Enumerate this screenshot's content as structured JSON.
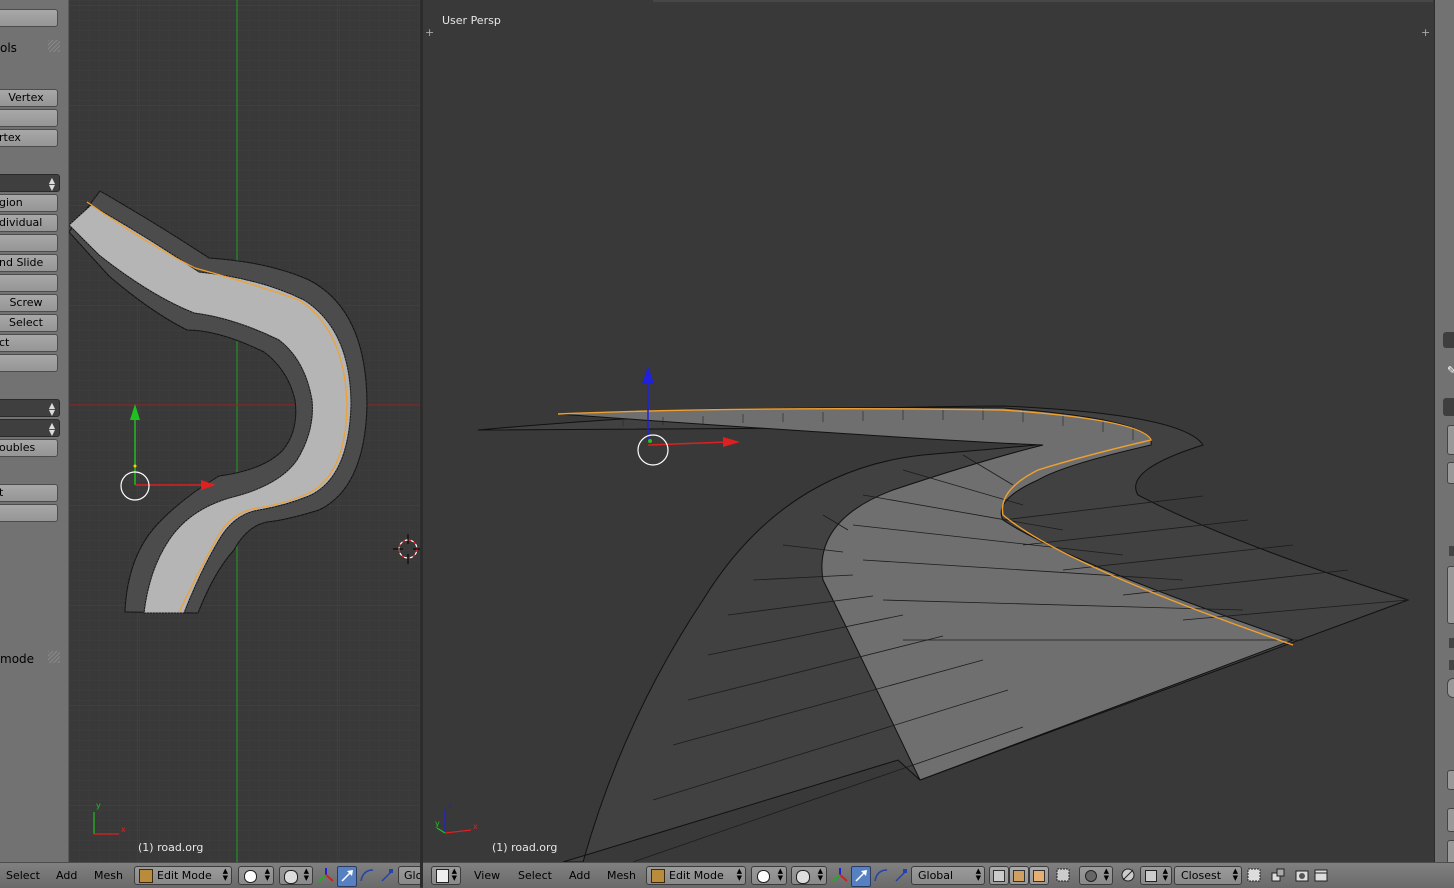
{
  "toolshelf": {
    "panel_tools_title": "ols",
    "panel_options_title": "mode",
    "buttons": [
      {
        "label": "Vertex",
        "align": "c"
      },
      {
        "label": "",
        "align": "c"
      },
      {
        "label": "rtex",
        "align": "l"
      },
      {
        "label": "gion",
        "align": "l"
      },
      {
        "label": "dividual",
        "align": "l"
      },
      {
        "label": "",
        "align": "c"
      },
      {
        "label": "nd Slide",
        "align": "l"
      },
      {
        "label": "",
        "align": "c"
      },
      {
        "label": "Screw",
        "align": "c"
      },
      {
        "label": "Select",
        "align": "c"
      },
      {
        "label": "ct",
        "align": "l"
      },
      {
        "label": "",
        "align": "c"
      },
      {
        "label": "oubles",
        "align": "l"
      },
      {
        "label": "t",
        "align": "l"
      },
      {
        "label": "",
        "align": "c"
      }
    ]
  },
  "left_viewport": {
    "object_label": "(1) road.org"
  },
  "right_viewport": {
    "view_name": "User Persp",
    "object_label": "(1) road.org"
  },
  "left_header": {
    "menus": [
      "Select",
      "Add",
      "Mesh"
    ],
    "mode": "Edit Mode",
    "orientation_truncated": "Glo"
  },
  "right_header": {
    "menus": [
      "View",
      "Select",
      "Add",
      "Mesh"
    ],
    "mode": "Edit Mode",
    "orientation": "Global",
    "snap_target": "Closest"
  },
  "colors": {
    "background": "#393939",
    "selection_edge": "#f0a030",
    "mesh_face": "#7d7d7d",
    "axis_x": "#dd2020",
    "axis_y": "#20c020",
    "axis_z": "#2020dd",
    "active_button": "#5680c2"
  }
}
